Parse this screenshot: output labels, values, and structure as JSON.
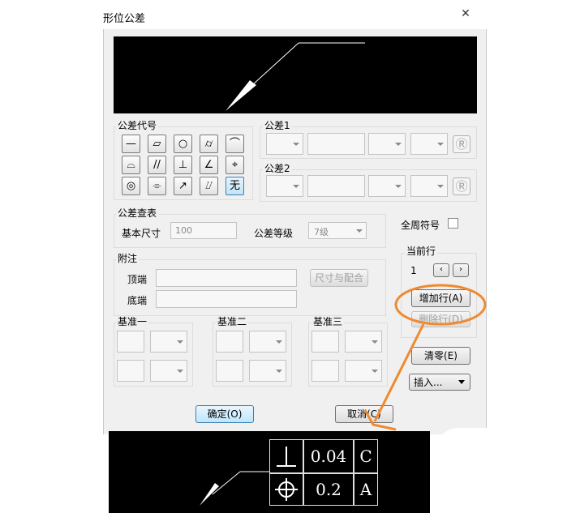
{
  "window": {
    "title": "形位公差",
    "close": "✕"
  },
  "groups": {
    "symbols": "公差代号",
    "tolerance1": "公差1",
    "tolerance2": "公差2",
    "lookup": "公差查表",
    "notes": "附注",
    "datum1": "基准一",
    "datum2": "基准二",
    "datum3": "基准三",
    "current_row": "当前行"
  },
  "symbols": [
    [
      "—",
      "▱",
      "○",
      "⌭",
      "⌒"
    ],
    [
      "⌓",
      "//",
      "⊥",
      "∠",
      "⌖"
    ],
    [
      "◎",
      "⌯",
      "↗",
      "⌰",
      "无"
    ]
  ],
  "tolerance": {
    "r_symbol": "Ⓡ"
  },
  "lookup": {
    "basic_size_label": "基本尺寸",
    "basic_size_value": "100",
    "grade_label": "公差等级",
    "grade_value": "7级"
  },
  "notes": {
    "top_label": "顶端",
    "bottom_label": "底端",
    "fit_button": "尺寸与配合"
  },
  "all_around_label": "全周符号",
  "current_row": {
    "value": "1",
    "prev": "‹",
    "next": "›"
  },
  "buttons": {
    "add_row": "增加行(A)",
    "delete_row": "删除行(D)",
    "clear": "清零(E)",
    "insert": "插入...",
    "ok": "确定(O)",
    "cancel": "取消(C)"
  },
  "frame": {
    "row1": {
      "symbol": "⊥",
      "value": "0.04",
      "datum": "C"
    },
    "row2": {
      "symbol": "⌖",
      "value": "0.2",
      "datum": "A"
    }
  },
  "colors": {
    "annotation": "#f08a30",
    "highlight": "#3c7fb1"
  }
}
